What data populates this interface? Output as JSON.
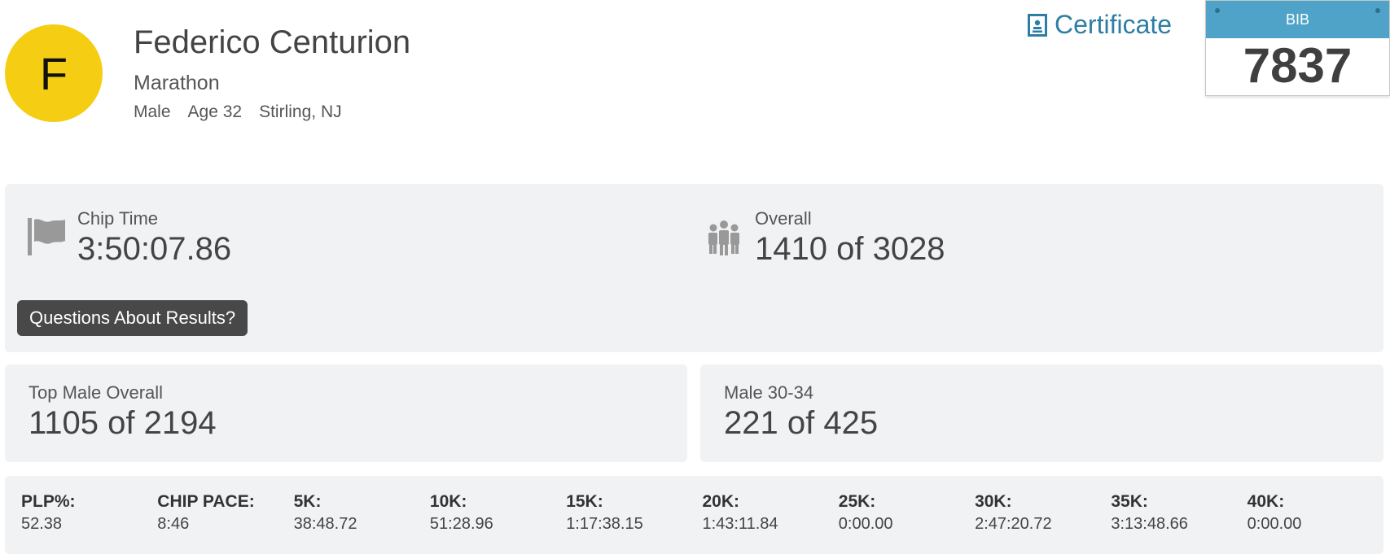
{
  "runner": {
    "initial": "F",
    "name": "Federico Centurion",
    "event": "Marathon",
    "gender": "Male",
    "age": "Age 32",
    "location": "Stirling, NJ"
  },
  "certificate": {
    "label": "Certificate"
  },
  "bib": {
    "label": "BIB",
    "number": "7837"
  },
  "chip_time": {
    "label": "Chip Time",
    "value": "3:50:07.86"
  },
  "overall": {
    "label": "Overall",
    "value": "1410 of 3028"
  },
  "questions_button": "Questions About Results?",
  "top_male": {
    "label": "Top Male Overall",
    "value": "1105 of 2194"
  },
  "age_group": {
    "label": "Male 30-34",
    "value": "221 of 425"
  },
  "splits": [
    {
      "label": "PLP%:",
      "value": "52.38"
    },
    {
      "label": "CHIP PACE:",
      "value": "8:46"
    },
    {
      "label": "5K:",
      "value": "38:48.72"
    },
    {
      "label": "10K:",
      "value": "51:28.96"
    },
    {
      "label": "15K:",
      "value": "1:17:38.15"
    },
    {
      "label": "20K:",
      "value": "1:43:11.84"
    },
    {
      "label": "25K:",
      "value": "0:00.00"
    },
    {
      "label": "30K:",
      "value": "2:47:20.72"
    },
    {
      "label": "35K:",
      "value": "3:13:48.66"
    },
    {
      "label": "40K:",
      "value": "0:00.00"
    }
  ],
  "icons": {
    "avatar": "avatar",
    "certificate": "certificate-icon",
    "chip_time": "flag-icon",
    "overall": "group-icon"
  },
  "colors": {
    "avatar_bg": "#f5cd12",
    "link": "#2e7ea3",
    "bib_header": "#4fa3c8",
    "panel_bg": "#f1f2f4",
    "button_bg": "#484848"
  }
}
